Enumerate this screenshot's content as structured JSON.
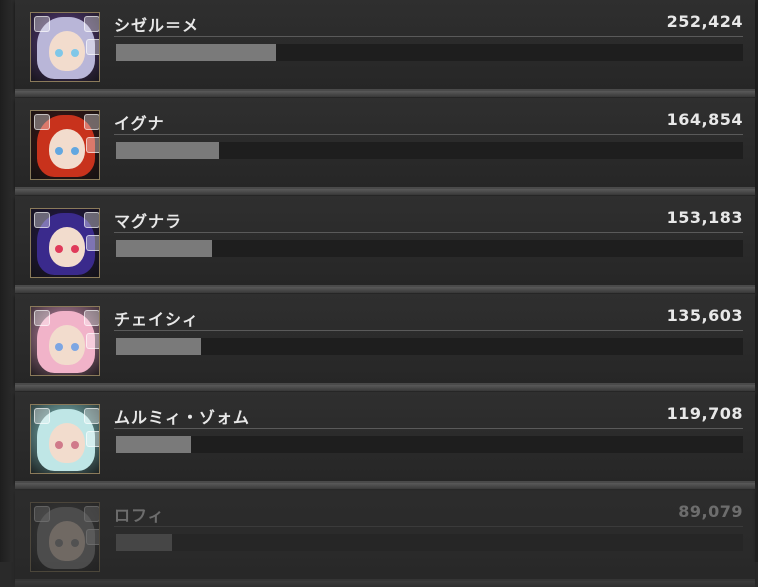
{
  "rankings": [
    {
      "name": "シゼル＝メ",
      "score": "252,424",
      "fraction": 0.255,
      "hair": "#b9b6d8",
      "bg": "#5d3f86",
      "eye": "#7fc7e8"
    },
    {
      "name": "イグナ",
      "score": "164,854",
      "fraction": 0.165,
      "hair": "#c8321c",
      "bg": "#401818",
      "eye": "#62a7e0"
    },
    {
      "name": "マグナラ",
      "score": "153,183",
      "fraction": 0.153,
      "hair": "#3a2a8c",
      "bg": "#271a4f",
      "eye": "#e03a5a"
    },
    {
      "name": "チェイシィ",
      "score": "135,603",
      "fraction": 0.135,
      "hair": "#f1b3c9",
      "bg": "#d497b8",
      "eye": "#7da6e3"
    },
    {
      "name": "ムルミィ・ゾォム",
      "score": "119,708",
      "fraction": 0.12,
      "hair": "#bfe6e6",
      "bg": "#8bcfcf",
      "eye": "#d07a8a"
    },
    {
      "name": "ロフィ",
      "score": "89,079",
      "fraction": 0.09,
      "hair": "#8a8a8a",
      "bg": "#555",
      "eye": "#999"
    }
  ]
}
